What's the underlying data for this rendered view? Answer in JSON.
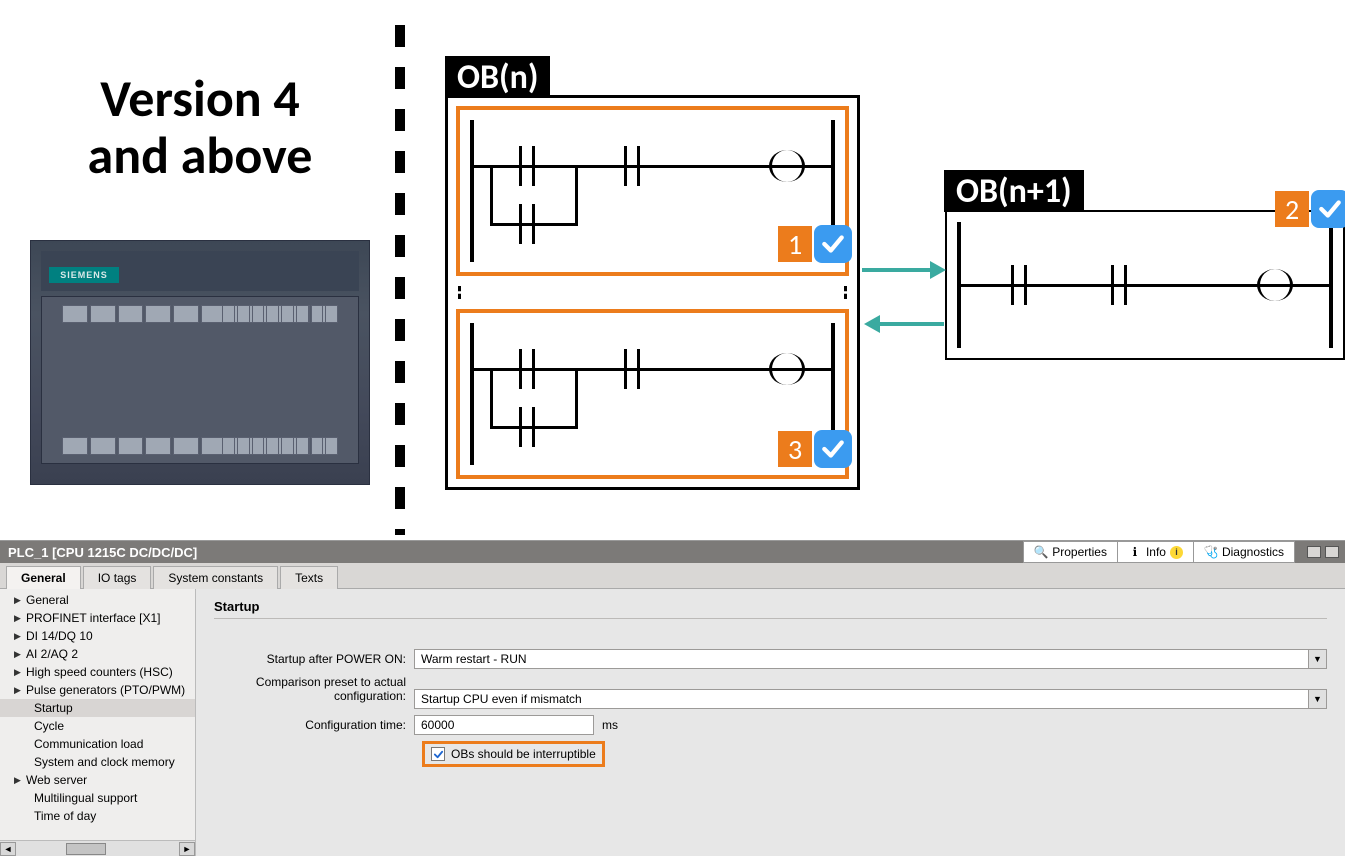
{
  "illustration": {
    "version_line1": "Version 4",
    "version_line2": "and above",
    "plc_brand": "SIEMENS",
    "ob_n_label": "OB(n)",
    "ob_n1_label": "OB(n+1)",
    "steps": {
      "1": "1",
      "2": "2",
      "3": "3"
    }
  },
  "header": {
    "title": "PLC_1 [CPU 1215C DC/DC/DC]",
    "tabs": {
      "properties": "Properties",
      "info": "Info",
      "diagnostics": "Diagnostics"
    }
  },
  "inner_tabs": {
    "general": "General",
    "io_tags": "IO tags",
    "system_constants": "System constants",
    "texts": "Texts"
  },
  "nav": [
    {
      "label": "General",
      "expandable": true
    },
    {
      "label": "PROFINET interface [X1]",
      "expandable": true
    },
    {
      "label": "DI 14/DQ 10",
      "expandable": true
    },
    {
      "label": "AI 2/AQ 2",
      "expandable": true
    },
    {
      "label": "High speed counters (HSC)",
      "expandable": true
    },
    {
      "label": "Pulse generators (PTO/PWM)",
      "expandable": true
    },
    {
      "label": "Startup",
      "sub": true,
      "selected": true
    },
    {
      "label": "Cycle",
      "sub": true
    },
    {
      "label": "Communication load",
      "sub": true
    },
    {
      "label": "System and clock memory",
      "sub": true
    },
    {
      "label": "Web server",
      "expandable": true
    },
    {
      "label": "Multilingual support",
      "sub": true
    },
    {
      "label": "Time of day",
      "sub": true
    }
  ],
  "form": {
    "section": "Startup",
    "startup_after_label": "Startup after POWER ON:",
    "startup_after_value": "Warm restart - RUN",
    "comparison_label1": "Comparison preset to actual",
    "comparison_label2": "configuration:",
    "comparison_value": "Startup CPU even if mismatch",
    "config_time_label": "Configuration time:",
    "config_time_value": "60000",
    "config_time_unit": "ms",
    "obs_interruptible_label": "OBs should be interruptible",
    "obs_interruptible_checked": true
  }
}
